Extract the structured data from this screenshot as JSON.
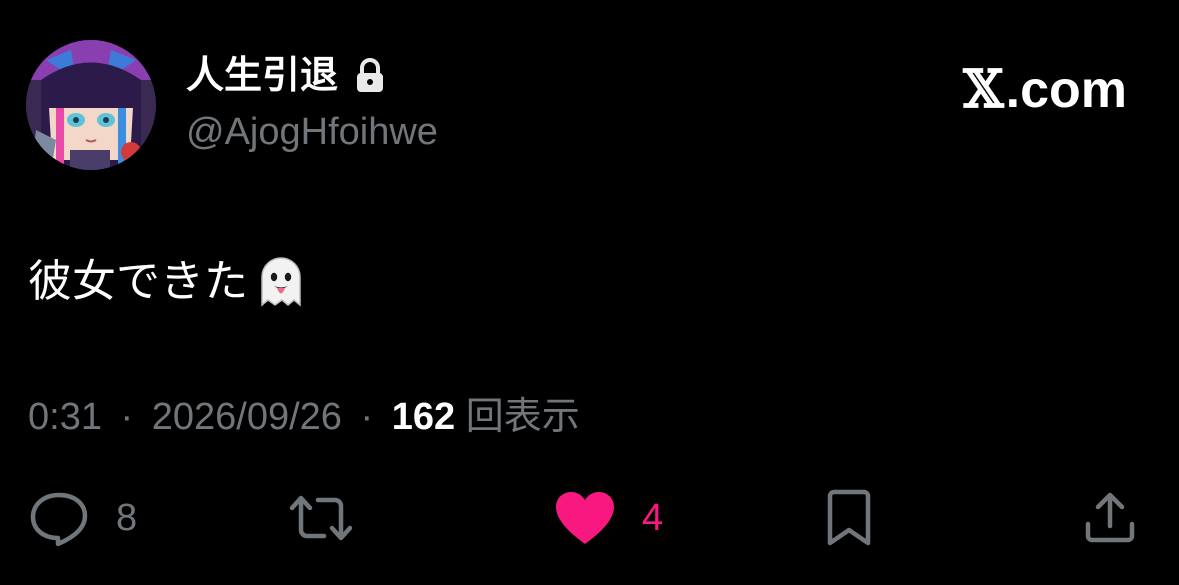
{
  "author": {
    "display_name": "人生引退",
    "handle": "@AjogHfoihwe",
    "protected_icon": "lock-icon",
    "avatar_icon": "avatar"
  },
  "brand": {
    "x_mark": "𝕏",
    "label": ".com"
  },
  "tweet": {
    "text": "彼女できた",
    "emoji_icon": "ghost-icon"
  },
  "meta": {
    "time": "0:31",
    "separator": "·",
    "date": "2026/09/26",
    "views_count": "162",
    "views_label": "回表示"
  },
  "actions": {
    "reply": {
      "icon": "reply-icon",
      "count": "8"
    },
    "retweet": {
      "icon": "retweet-icon",
      "count": ""
    },
    "like": {
      "icon": "heart-icon",
      "count": "4",
      "liked": true
    },
    "bookmark": {
      "icon": "bookmark-icon"
    },
    "share": {
      "icon": "share-icon"
    }
  },
  "colors": {
    "background": "#000000",
    "primary_text": "#ffffff",
    "secondary_text": "#71767b",
    "like": "#f91880"
  }
}
